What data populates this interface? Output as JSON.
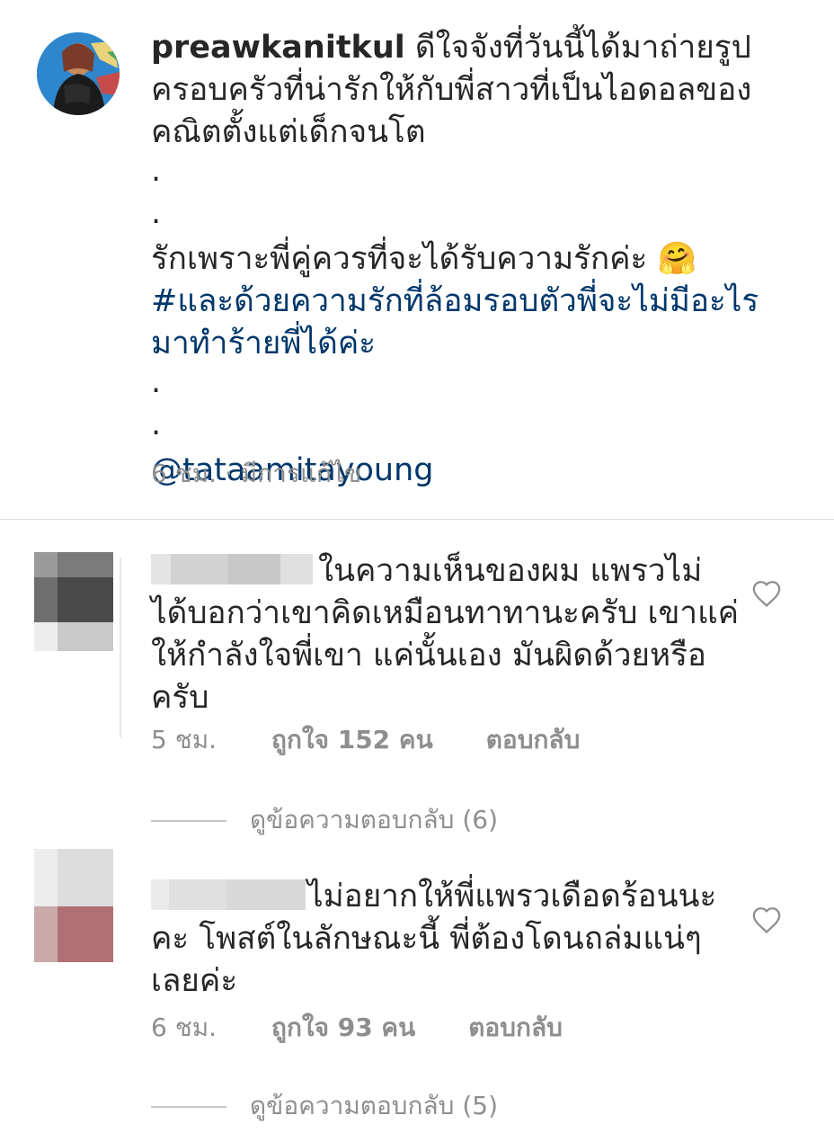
{
  "caption": {
    "username": "preawkanitkul",
    "line1": "ดีใจจังที่วันนี้ได้มาถ่ายรูป",
    "line2": "ครอบครัวที่น่ารักให้กับพี่สาวที่เป็นไอดอลของ",
    "line3": "คณิตตั้งแต่เด็กจนโต",
    "dot": ".",
    "line4": "รักเพราะพี่คู่ควรที่จะได้รับความรักค่ะ",
    "emoji": "🤗",
    "hashtag_line1": "#และด้วยความรักที่ล้อมรอบตัวพี่จะไม่มีอะไร",
    "hashtag_line2": "มาทำร้ายพี่ได้ค่ะ",
    "mention": "@tataamitayoung",
    "time": "6 ชม.",
    "separator": " · ",
    "edited": "มีการแก้ไข"
  },
  "comments": [
    {
      "line1": "ในความเห็นของผม แพรวไม่",
      "line2": "ได้บอกว่าเขาคิดเหมือนทาทานะครับ เขาแค่",
      "line3": "ให้กำลังใจพี่เขา แค่นั้นเอง มันผิดด้วยหรือ",
      "line4": "ครับ",
      "time": "5 ชม.",
      "likes": "ถูกใจ 152 คน",
      "reply": "ตอบกลับ",
      "view_replies": "ดูข้อความตอบกลับ (6)"
    },
    {
      "line1": "ไม่อยากให้พี่แพรวเดือดร้อนนะ",
      "line2": "คะ โพสต์ในลักษณะนี้ พี่ต้องโดนถล่มแน่ๆ",
      "line3": "เลยค่ะ",
      "time": "6 ชม.",
      "likes": "ถูกใจ 93 คน",
      "reply": "ตอบกลับ",
      "view_replies": "ดูข้อความตอบกลับ (5)"
    }
  ],
  "colors": {
    "text": "#262626",
    "secondary": "#8e8e8e",
    "link": "#00376b",
    "divider": "#dbdbdb"
  },
  "icons": [
    "heart-outline-icon"
  ]
}
